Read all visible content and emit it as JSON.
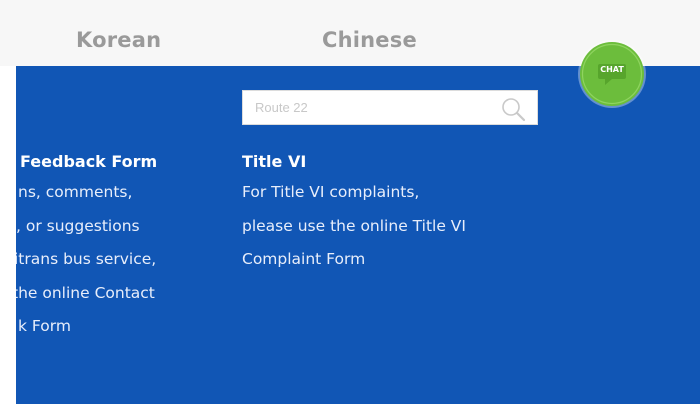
{
  "languages": {
    "korean": "Korean",
    "chinese": "Chinese"
  },
  "search": {
    "placeholder": "Route 22",
    "icon": "search-icon"
  },
  "chat": {
    "label": "CHAT",
    "color": "#6cbd3c"
  },
  "feedback": {
    "heading": "Feedback Form",
    "lines": [
      "ns, comments,",
      ", or suggestions",
      "itrans bus service,",
      "the online Contact",
      "k Form"
    ]
  },
  "title_vi": {
    "heading": "Title VI",
    "lines": [
      "For Title VI complaints,",
      "please use the online Title VI",
      "Complaint Form"
    ]
  },
  "colors": {
    "panel_blue": "#1156b5",
    "lang_bar": "#f7f7f7",
    "lang_text": "#9a9a9a"
  }
}
